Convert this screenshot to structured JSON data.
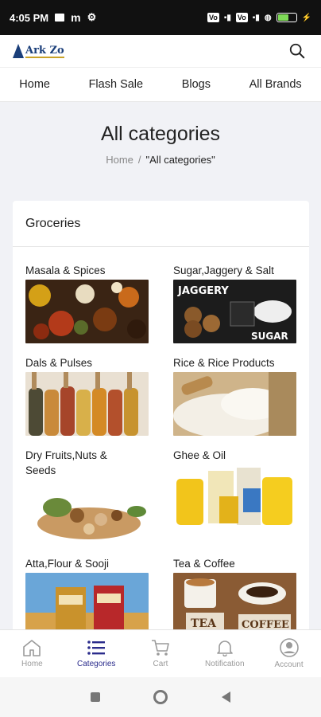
{
  "status_bar": {
    "time": "4:05 PM",
    "battery": "60",
    "battery_level": 0.6
  },
  "header": {
    "logo_text": "Ark Zo",
    "search_icon": "search-icon"
  },
  "nav": {
    "items": [
      "Home",
      "Flash Sale",
      "Blogs",
      "All Brands"
    ]
  },
  "page": {
    "title": "All categories",
    "breadcrumb": {
      "home": "Home",
      "separator": "/",
      "current": "\"All categories\""
    }
  },
  "section": {
    "title": "Groceries",
    "categories": [
      {
        "label": "Masala & Spices",
        "image": "spices-photo"
      },
      {
        "label": "Sugar,Jaggery & Salt",
        "image": "jaggery-sugar-photo",
        "overlay": [
          "JAGGERY",
          "SUGAR"
        ]
      },
      {
        "label": "Dals & Pulses",
        "image": "pulses-scoops-photo"
      },
      {
        "label": "Rice & Rice Products",
        "image": "rice-sack-photo"
      },
      {
        "label": "Dry Fruits,Nuts & Seeds",
        "image": "dry-fruits-photo"
      },
      {
        "label": "Ghee & Oil",
        "image": "ghee-oil-products-photo"
      },
      {
        "label": "Atta,Flour & Sooji",
        "image": "atta-packs-photo"
      },
      {
        "label": "Tea & Coffee",
        "image": "tea-coffee-photo",
        "overlay": [
          "TEA",
          "COFFEE"
        ]
      }
    ]
  },
  "bottom_nav": {
    "items": [
      {
        "label": "Home",
        "icon": "home-icon"
      },
      {
        "label": "Categories",
        "icon": "list-icon",
        "active": true
      },
      {
        "label": "Cart",
        "icon": "cart-icon"
      },
      {
        "label": "Notification",
        "icon": "bell-icon"
      },
      {
        "label": "Account",
        "icon": "account-icon"
      }
    ]
  },
  "colors": {
    "accent": "#2b2c8c",
    "page_bg": "#f1f2f6",
    "inactive": "#9a9a9a"
  }
}
